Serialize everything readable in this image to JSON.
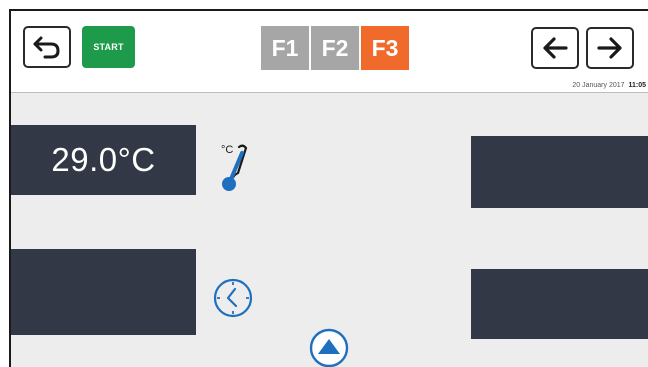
{
  "header": {
    "back_icon": "undo-arrow-icon",
    "start_label": "START",
    "tabs": [
      {
        "label": "F1",
        "active": false
      },
      {
        "label": "F2",
        "active": false
      },
      {
        "label": "F3",
        "active": true
      }
    ],
    "prev_icon": "arrow-left-icon",
    "next_icon": "arrow-right-icon",
    "date": "20 January 2017",
    "time": "11:05"
  },
  "main": {
    "temperature_value": "29.0°C",
    "thermometer_icon": "thermometer-celsius-icon",
    "clock_icon": "clock-icon",
    "up_icon": "arrow-up-circle-icon"
  },
  "colors": {
    "accent": "#f06a2c",
    "start": "#1e9a4b",
    "panel": "#323845",
    "tab_inactive": "#a6a6a6",
    "icon_blue": "#1f6fbf"
  }
}
